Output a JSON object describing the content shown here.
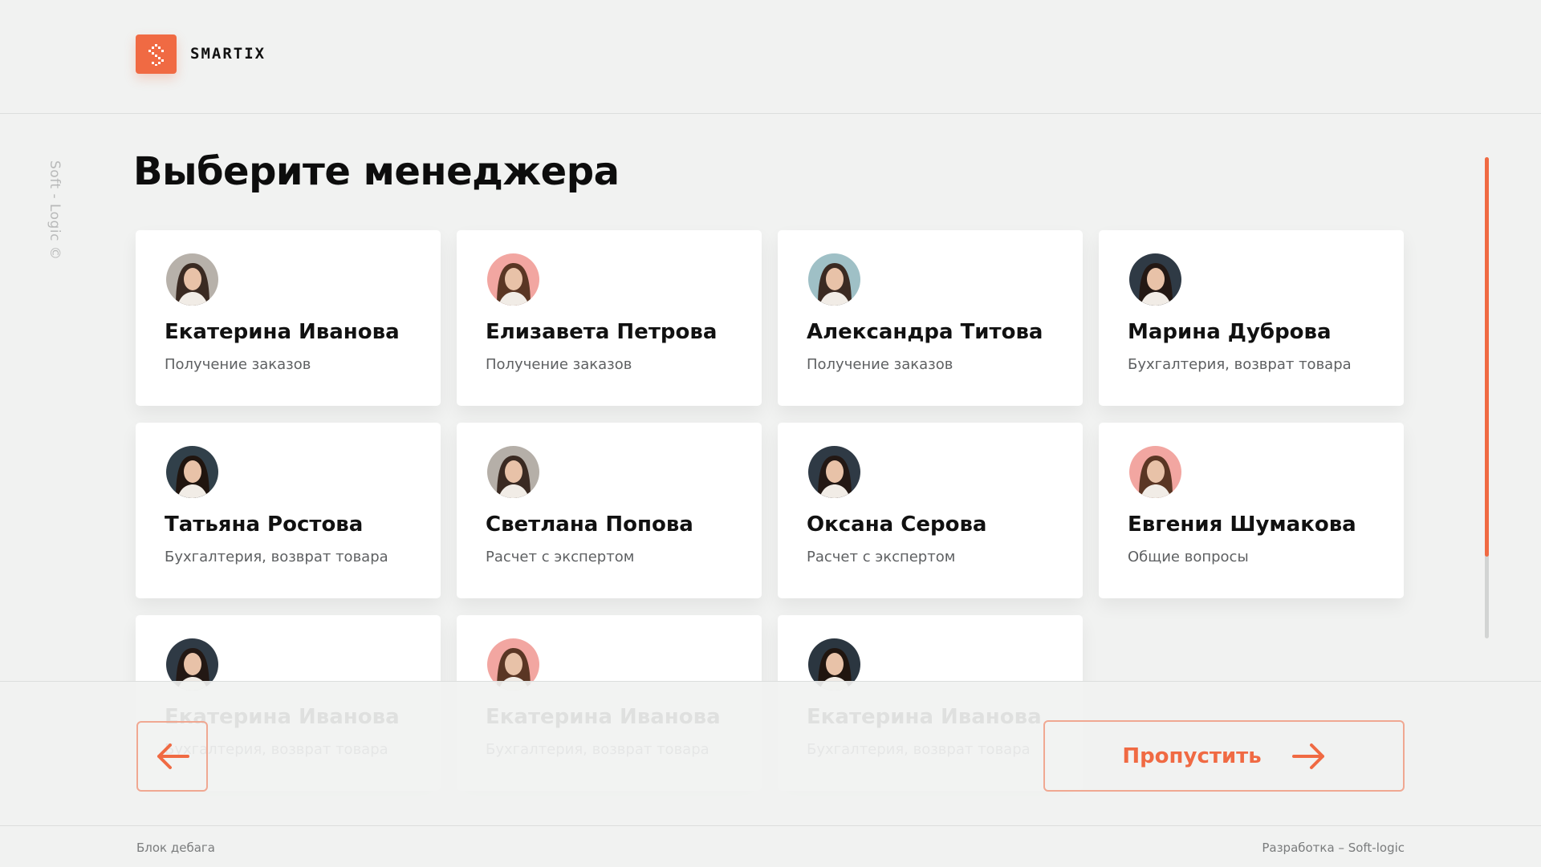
{
  "brand": {
    "name": "SMARTIX",
    "accent": "#f06a43"
  },
  "side_text": "Soft - Logic ©",
  "title": "Выберите менеджера",
  "managers": [
    {
      "name": "Екатерина Иванова",
      "role": "Получение заказов",
      "avatar_bg": "#b7b1aa",
      "hair": "#3a2a22"
    },
    {
      "name": "Елизавета Петрова",
      "role": "Получение заказов",
      "avatar_bg": "#f2a6a1",
      "hair": "#5a3624"
    },
    {
      "name": "Александра Титова",
      "role": "Получение заказов",
      "avatar_bg": "#9fc0c6",
      "hair": "#3b2a22"
    },
    {
      "name": "Марина Дуброва",
      "role": "Бухгалтерия, возврат товара",
      "avatar_bg": "#2f3a45",
      "hair": "#231814"
    },
    {
      "name": "Татьяна Ростова",
      "role": "Бухгалтерия, возврат товара",
      "avatar_bg": "#31404a",
      "hair": "#20150f"
    },
    {
      "name": "Светлана Попова",
      "role": "Расчет с экспертом",
      "avatar_bg": "#b5afa8",
      "hair": "#3a2a22"
    },
    {
      "name": "Оксана Серова",
      "role": "Расчет с экспертом",
      "avatar_bg": "#2f3a45",
      "hair": "#231814"
    },
    {
      "name": "Евгения Шумакова",
      "role": "Общие вопросы",
      "avatar_bg": "#f2a6a1",
      "hair": "#5a3624"
    },
    {
      "name": "Екатерина Иванова",
      "role": "Бухгалтерия, возврат товара",
      "avatar_bg": "#2f3a45",
      "hair": "#231814"
    },
    {
      "name": "Екатерина Иванова",
      "role": "Бухгалтерия, возврат товара",
      "avatar_bg": "#f2a6a1",
      "hair": "#5a3624"
    },
    {
      "name": "Екатерина Иванова",
      "role": "Бухгалтерия, возврат товара",
      "avatar_bg": "#2b3640",
      "hair": "#20150f"
    }
  ],
  "nav": {
    "back_icon": "arrow-left-icon",
    "skip_label": "Пропустить",
    "skip_icon": "arrow-right-icon"
  },
  "scroll": {
    "position_fraction": 0.83
  },
  "footer": {
    "left": "Блок дебага",
    "right": "Разработка – Soft-logic"
  }
}
